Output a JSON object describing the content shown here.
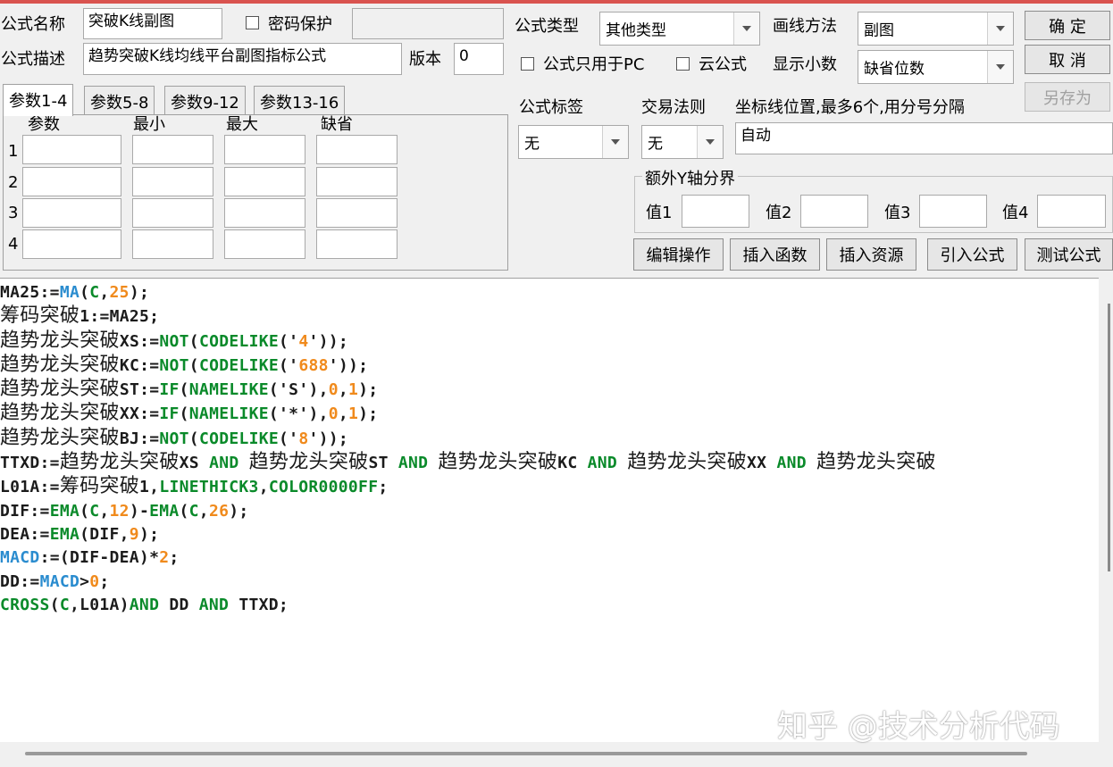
{
  "header": {
    "name_label": "公式名称",
    "name_value": "突破K线副图",
    "password_label": "密码保护",
    "desc_label": "公式描述",
    "desc_value": "趋势突破K线均线平台副图指标公式",
    "version_label": "版本",
    "version_value": "0",
    "type_label": "公式类型",
    "type_value": "其他类型",
    "draw_label": "画线方法",
    "draw_value": "副图",
    "pc_only_label": "公式只用于PC",
    "cloud_label": "云公式",
    "decimal_label": "显示小数",
    "decimal_value": "缺省位数"
  },
  "buttons": {
    "confirm": "确  定",
    "cancel": "取  消",
    "save_as": "另存为",
    "edit_ops": "编辑操作",
    "insert_func": "插入函数",
    "insert_res": "插入资源",
    "import_formula": "引入公式",
    "test_formula": "测试公式"
  },
  "tabs": [
    "参数1-4",
    "参数5-8",
    "参数9-12",
    "参数13-16"
  ],
  "params": {
    "columns": [
      "参数",
      "最小",
      "最大",
      "缺省"
    ],
    "rows": [
      "1",
      "2",
      "3",
      "4"
    ]
  },
  "options": {
    "tag_label": "公式标签",
    "tag_value": "无",
    "rule_label": "交易法则",
    "rule_value": "无",
    "coord_label": "坐标线位置,最多6个,用分号分隔",
    "coord_value": "自动",
    "yaxis_title": "额外Y轴分界",
    "yaxis_fields": [
      "值1",
      "值2",
      "值3",
      "值4"
    ]
  },
  "code_lines": [
    [
      [
        "MA25:=",
        "var"
      ],
      [
        "MA",
        "fn"
      ],
      [
        "(",
        "var"
      ],
      [
        "C",
        "kw"
      ],
      [
        ",",
        "var"
      ],
      [
        "25",
        "num"
      ],
      [
        ");",
        "var"
      ]
    ],
    [
      [
        "筹码突破",
        "cjk"
      ],
      [
        "1:=MA25;",
        "var"
      ]
    ],
    [
      [
        "趋势龙头突破",
        "cjk"
      ],
      [
        "XS:=",
        "var"
      ],
      [
        "NOT",
        "kw"
      ],
      [
        "(",
        "var"
      ],
      [
        "CODELIKE",
        "kw"
      ],
      [
        "('",
        "var"
      ],
      [
        "4",
        "num"
      ],
      [
        "'));",
        "var"
      ]
    ],
    [
      [
        "趋势龙头突破",
        "cjk"
      ],
      [
        "KC:=",
        "var"
      ],
      [
        "NOT",
        "kw"
      ],
      [
        "(",
        "var"
      ],
      [
        "CODELIKE",
        "kw"
      ],
      [
        "('",
        "var"
      ],
      [
        "688",
        "num"
      ],
      [
        "'));",
        "var"
      ]
    ],
    [
      [
        "趋势龙头突破",
        "cjk"
      ],
      [
        "ST:=",
        "var"
      ],
      [
        "IF",
        "kw"
      ],
      [
        "(",
        "var"
      ],
      [
        "NAMELIKE",
        "kw"
      ],
      [
        "('S'),",
        "var"
      ],
      [
        "0",
        "num"
      ],
      [
        ",",
        "var"
      ],
      [
        "1",
        "num"
      ],
      [
        ");",
        "var"
      ]
    ],
    [
      [
        "趋势龙头突破",
        "cjk"
      ],
      [
        "XX:=",
        "var"
      ],
      [
        "IF",
        "kw"
      ],
      [
        "(",
        "var"
      ],
      [
        "NAMELIKE",
        "kw"
      ],
      [
        "('*'),",
        "var"
      ],
      [
        "0",
        "num"
      ],
      [
        ",",
        "var"
      ],
      [
        "1",
        "num"
      ],
      [
        ");",
        "var"
      ]
    ],
    [
      [
        "趋势龙头突破",
        "cjk"
      ],
      [
        "BJ:=",
        "var"
      ],
      [
        "NOT",
        "kw"
      ],
      [
        "(",
        "var"
      ],
      [
        "CODELIKE",
        "kw"
      ],
      [
        "('",
        "var"
      ],
      [
        "8",
        "num"
      ],
      [
        "'));",
        "var"
      ]
    ],
    [
      [
        "TTXD:=",
        "var"
      ],
      [
        "趋势龙头突破",
        "cjk"
      ],
      [
        "XS ",
        "var"
      ],
      [
        "AND",
        "kw"
      ],
      [
        " ",
        "var"
      ],
      [
        "趋势龙头突破",
        "cjk"
      ],
      [
        "ST ",
        "var"
      ],
      [
        "AND",
        "kw"
      ],
      [
        " ",
        "var"
      ],
      [
        "趋势龙头突破",
        "cjk"
      ],
      [
        "KC ",
        "var"
      ],
      [
        "AND",
        "kw"
      ],
      [
        " ",
        "var"
      ],
      [
        "趋势龙头突破",
        "cjk"
      ],
      [
        "XX ",
        "var"
      ],
      [
        "AND",
        "kw"
      ],
      [
        " ",
        "var"
      ],
      [
        "趋势龙头突破",
        "cjk"
      ]
    ],
    [
      [
        "L01A:=",
        "var"
      ],
      [
        "筹码突破",
        "cjk"
      ],
      [
        "1,",
        "var"
      ],
      [
        "LINETHICK3",
        "kw"
      ],
      [
        ",",
        "var"
      ],
      [
        "COLOR0000FF",
        "kw"
      ],
      [
        ";",
        "var"
      ]
    ],
    [
      [
        "DIF:=",
        "var"
      ],
      [
        "EMA",
        "kw"
      ],
      [
        "(",
        "var"
      ],
      [
        "C",
        "kw"
      ],
      [
        ",",
        "var"
      ],
      [
        "12",
        "num"
      ],
      [
        ")-",
        "var"
      ],
      [
        "EMA",
        "kw"
      ],
      [
        "(",
        "var"
      ],
      [
        "C",
        "kw"
      ],
      [
        ",",
        "var"
      ],
      [
        "26",
        "num"
      ],
      [
        ");",
        "var"
      ]
    ],
    [
      [
        "DEA:=",
        "var"
      ],
      [
        "EMA",
        "kw"
      ],
      [
        "(DIF,",
        "var"
      ],
      [
        "9",
        "num"
      ],
      [
        ");",
        "var"
      ]
    ],
    [
      [
        "MACD",
        "fn"
      ],
      [
        ":=(DIF-DEA)*",
        "var"
      ],
      [
        "2",
        "num"
      ],
      [
        ";",
        "var"
      ]
    ],
    [
      [
        "DD:=",
        "var"
      ],
      [
        "MACD",
        "fn"
      ],
      [
        ">",
        "var"
      ],
      [
        "0",
        "num"
      ],
      [
        ";",
        "var"
      ]
    ],
    [
      [
        "CROSS",
        "kw"
      ],
      [
        "(",
        "var"
      ],
      [
        "C",
        "kw"
      ],
      [
        ",L01A)",
        "var"
      ],
      [
        "AND",
        "kw"
      ],
      [
        " DD ",
        "var"
      ],
      [
        "AND",
        "kw"
      ],
      [
        " TTXD;",
        "var"
      ]
    ]
  ],
  "watermark": "知乎 @技术分析代码"
}
